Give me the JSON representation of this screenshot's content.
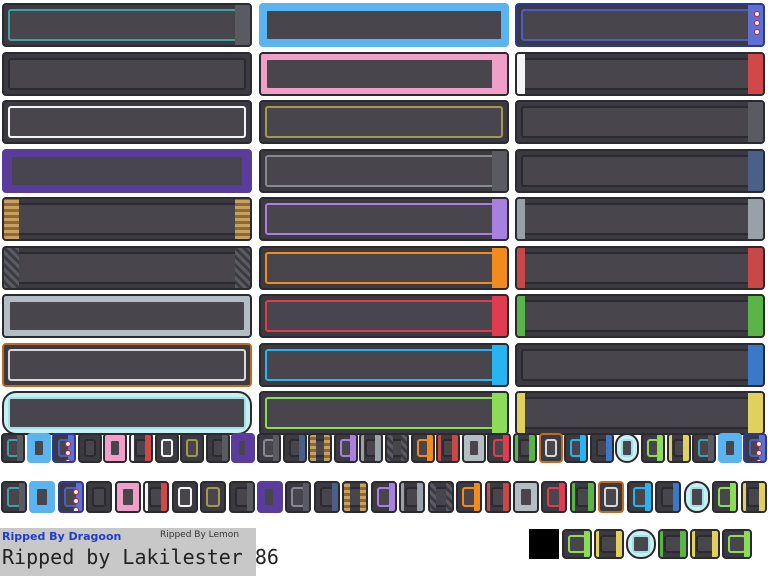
{
  "credits": {
    "line1": "Ripped  By Dragoon",
    "line2": "Ripped By Lemon",
    "line3": "Ripped by Lakilester 86"
  },
  "palette": {
    "dark_fill": "#48464c",
    "outline": "#2a2a30",
    "white": "#f4f4f4",
    "sky_blue": "#5ab4f0",
    "navy_blue": "#2838a0",
    "pink": "#f0a0c8",
    "red": "#d04848",
    "purple": "#5a3c9c",
    "lavender": "#a880e0",
    "orange": "#f08c1e",
    "crimson": "#e03c50",
    "cyan": "#28b4f0",
    "lime": "#8cdc5a",
    "green": "#5ab448",
    "yellow": "#e0d060",
    "tan": "#c8a060",
    "steel": "#6a86b0",
    "silver": "#b4bcc4",
    "teal": "#40a0a8"
  },
  "sprite_sheet": {
    "name": "text box frame sprite sheet",
    "columns": 3,
    "rows": 9,
    "large_frames": [
      {
        "style": "teal-outline"
      },
      {
        "style": "sky-blue"
      },
      {
        "style": "navy-pokeball"
      },
      {
        "style": "plain-dark"
      },
      {
        "style": "pink-scalloped"
      },
      {
        "style": "white-red-cap"
      },
      {
        "style": "white-outline"
      },
      {
        "style": "olive-outline"
      },
      {
        "style": "gray-cap"
      },
      {
        "style": "purple-rivets"
      },
      {
        "style": "gray-cap-2"
      },
      {
        "style": "steel-blue-cap"
      },
      {
        "style": "tan-plaid"
      },
      {
        "style": "lavender"
      },
      {
        "style": "silver-cap"
      },
      {
        "style": "checker-gray"
      },
      {
        "style": "orange"
      },
      {
        "style": "red-cap"
      },
      {
        "style": "silver-metal"
      },
      {
        "style": "crimson"
      },
      {
        "style": "green-cap"
      },
      {
        "style": "orange-line"
      },
      {
        "style": "cyan"
      },
      {
        "style": "blue-cap"
      },
      {
        "style": "cloud-mint"
      },
      {
        "style": "lime"
      },
      {
        "style": "yellow-cap"
      }
    ],
    "small_tiles_row1": 30,
    "small_tiles_row2": 27,
    "bottom_right_tiles": 7
  }
}
